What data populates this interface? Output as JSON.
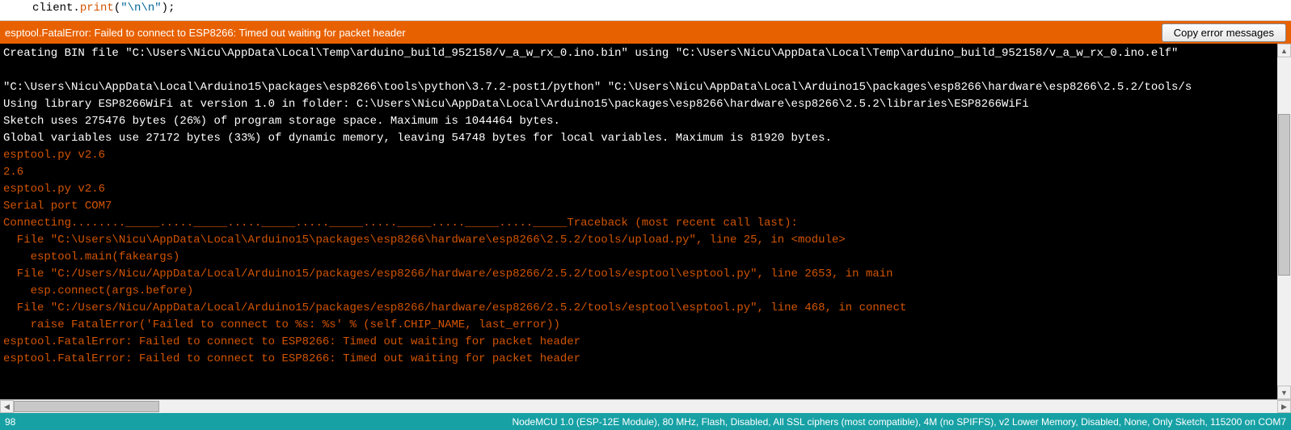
{
  "code": {
    "obj": "client",
    "fn": "print",
    "str": "\"\\n\\n\"",
    "tail": ");"
  },
  "errorbar": {
    "message": "esptool.FatalError: Failed to connect to ESP8266: Timed out waiting for packet header",
    "copy_label": "Copy error messages"
  },
  "console_lines": [
    {
      "c": "w",
      "t": "Creating BIN file \"C:\\Users\\Nicu\\AppData\\Local\\Temp\\arduino_build_952158/v_a_w_rx_0.ino.bin\" using \"C:\\Users\\Nicu\\AppData\\Local\\Temp\\arduino_build_952158/v_a_w_rx_0.ino.elf\""
    },
    {
      "c": "w",
      "t": ""
    },
    {
      "c": "w",
      "t": "\"C:\\Users\\Nicu\\AppData\\Local\\Arduino15\\packages\\esp8266\\tools\\python\\3.7.2-post1/python\" \"C:\\Users\\Nicu\\AppData\\Local\\Arduino15\\packages\\esp8266\\hardware\\esp8266\\2.5.2/tools/s"
    },
    {
      "c": "w",
      "t": "Using library ESP8266WiFi at version 1.0 in folder: C:\\Users\\Nicu\\AppData\\Local\\Arduino15\\packages\\esp8266\\hardware\\esp8266\\2.5.2\\libraries\\ESP8266WiFi "
    },
    {
      "c": "w",
      "t": "Sketch uses 275476 bytes (26%) of program storage space. Maximum is 1044464 bytes."
    },
    {
      "c": "w",
      "t": "Global variables use 27172 bytes (33%) of dynamic memory, leaving 54748 bytes for local variables. Maximum is 81920 bytes."
    },
    {
      "c": "o",
      "t": "esptool.py v2.6"
    },
    {
      "c": "o",
      "t": "2.6"
    },
    {
      "c": "o",
      "t": "esptool.py v2.6"
    },
    {
      "c": "o",
      "t": "Serial port COM7"
    },
    {
      "c": "o",
      "t": "Connecting........_____....._____....._____....._____....._____....._____....._____Traceback (most recent call last):"
    },
    {
      "c": "o",
      "t": "  File \"C:\\Users\\Nicu\\AppData\\Local\\Arduino15\\packages\\esp8266\\hardware\\esp8266\\2.5.2/tools/upload.py\", line 25, in <module>"
    },
    {
      "c": "o",
      "t": "    esptool.main(fakeargs)"
    },
    {
      "c": "o",
      "t": "  File \"C:/Users/Nicu/AppData/Local/Arduino15/packages/esp8266/hardware/esp8266/2.5.2/tools/esptool\\esptool.py\", line 2653, in main"
    },
    {
      "c": "o",
      "t": "    esp.connect(args.before)"
    },
    {
      "c": "o",
      "t": "  File \"C:/Users/Nicu/AppData/Local/Arduino15/packages/esp8266/hardware/esp8266/2.5.2/tools/esptool\\esptool.py\", line 468, in connect"
    },
    {
      "c": "o",
      "t": "    raise FatalError('Failed to connect to %s: %s' % (self.CHIP_NAME, last_error))"
    },
    {
      "c": "o",
      "t": "esptool.FatalError: Failed to connect to ESP8266: Timed out waiting for packet header"
    },
    {
      "c": "o",
      "t": "esptool.FatalError: Failed to connect to ESP8266: Timed out waiting for packet header"
    },
    {
      "c": "o",
      "t": ""
    }
  ],
  "status": {
    "line": "98",
    "board": "NodeMCU 1.0 (ESP-12E Module), 80 MHz, Flash, Disabled, All SSL ciphers (most compatible), 4M (no SPIFFS), v2 Lower Memory, Disabled, None, Only Sketch, 115200 on COM7"
  },
  "scroll": {
    "left_arrow": "◀",
    "right_arrow": "▶",
    "up_arrow": "▲",
    "down_arrow": "▼"
  }
}
